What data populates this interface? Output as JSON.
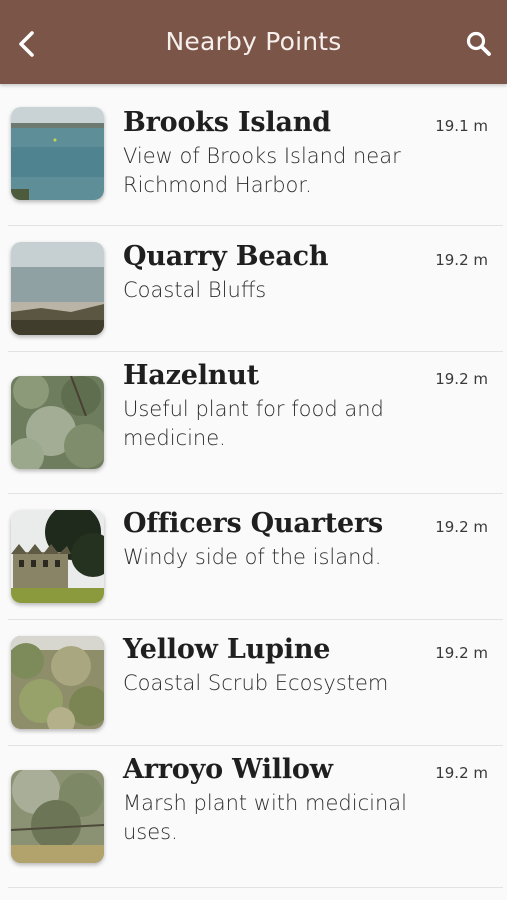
{
  "header": {
    "title": "Nearby Points",
    "back_icon": "chevron-left-icon",
    "search_icon": "search-icon",
    "background_color": "#7a5548"
  },
  "points": [
    {
      "name": "Brooks Island",
      "description": "View of Brooks Island near Richmond Harbor.",
      "distance": "19.1 m"
    },
    {
      "name": "Quarry Beach",
      "description": "Coastal Bluffs",
      "distance": "19.2 m"
    },
    {
      "name": "Hazelnut",
      "description": "Useful plant for food and medicine.",
      "distance": "19.2 m"
    },
    {
      "name": "Officers Quarters",
      "description": "Windy side of the island.",
      "distance": "19.2 m"
    },
    {
      "name": "Yellow Lupine",
      "description": "Coastal Scrub Ecosystem",
      "distance": "19.2 m"
    },
    {
      "name": "Arroyo Willow",
      "description": "Marsh plant with medicinal uses.",
      "distance": "19.2 m"
    }
  ]
}
